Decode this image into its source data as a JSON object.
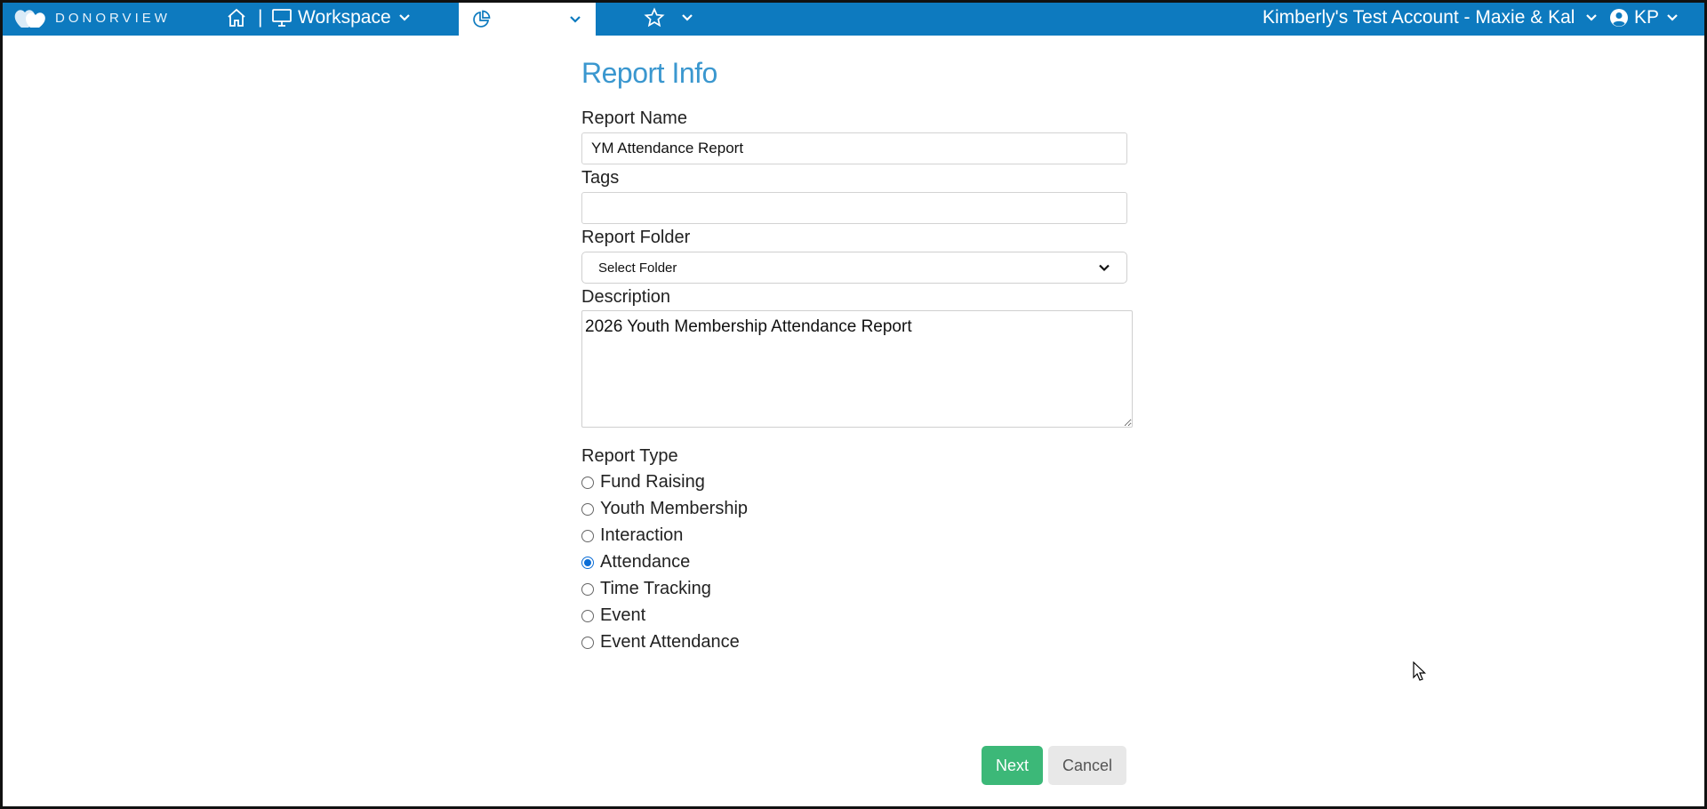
{
  "navbar": {
    "logo_text": "DONORVIEW",
    "separator": "|",
    "workspace_label": "Workspace",
    "reports_label": "Reports",
    "account_label": "Kimberly's Test Account - Maxie & Kal",
    "user_initials": "KP",
    "bg_color": "#0d7abf"
  },
  "form": {
    "title": "Report Info",
    "report_name_label": "Report Name",
    "report_name_value": "YM Attendance Report",
    "tags_label": "Tags",
    "tags_value": "",
    "folder_label": "Report Folder",
    "folder_selected": "Select Folder",
    "description_label": "Description",
    "description_value": "2026 Youth Membership Attendance Report",
    "report_type_label": "Report Type",
    "report_types": [
      {
        "label": "Fund Raising",
        "checked": false
      },
      {
        "label": "Youth Membership",
        "checked": false
      },
      {
        "label": "Interaction",
        "checked": false
      },
      {
        "label": "Attendance",
        "checked": true
      },
      {
        "label": "Time Tracking",
        "checked": false
      },
      {
        "label": "Event",
        "checked": false
      },
      {
        "label": "Event Attendance",
        "checked": false
      }
    ]
  },
  "buttons": {
    "next_label": "Next",
    "cancel_label": "Cancel",
    "next_color": "#3cb878"
  }
}
